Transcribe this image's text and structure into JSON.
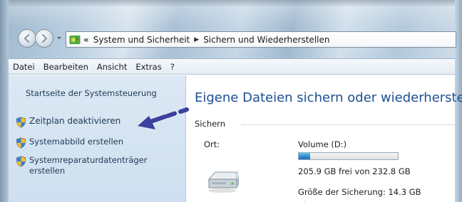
{
  "address": {
    "overflow": "«",
    "crumbs": [
      "System und Sicherheit",
      "Sichern und Wiederherstellen"
    ]
  },
  "menu": [
    "Datei",
    "Bearbeiten",
    "Ansicht",
    "Extras",
    "?"
  ],
  "leftpane": {
    "home_link": "Startseite der Systemsteuerung",
    "tasks": [
      "Zeitplan deaktivieren",
      "Systemabbild erstellen",
      "Systemreparaturdatenträger erstellen"
    ]
  },
  "main": {
    "title": "Eigene Dateien sichern oder wiederherstellen",
    "section": "Sichern",
    "location_label": "Ort:",
    "volume": "Volume (D:)",
    "usage_fraction": 0.116,
    "free_text": "205.9 GB frei von 232.8 GB",
    "backup_size": "Größe der Sicherung: 14.3 GB"
  },
  "colors": {
    "title_blue": "#1d4f91",
    "annotation_arrow": "#3b3f9e",
    "usage_bar": "#2b8fd0"
  },
  "icons": [
    "back-arrow-icon",
    "forward-arrow-icon",
    "control-panel-icon",
    "shield-icon",
    "hard-drive-icon"
  ]
}
